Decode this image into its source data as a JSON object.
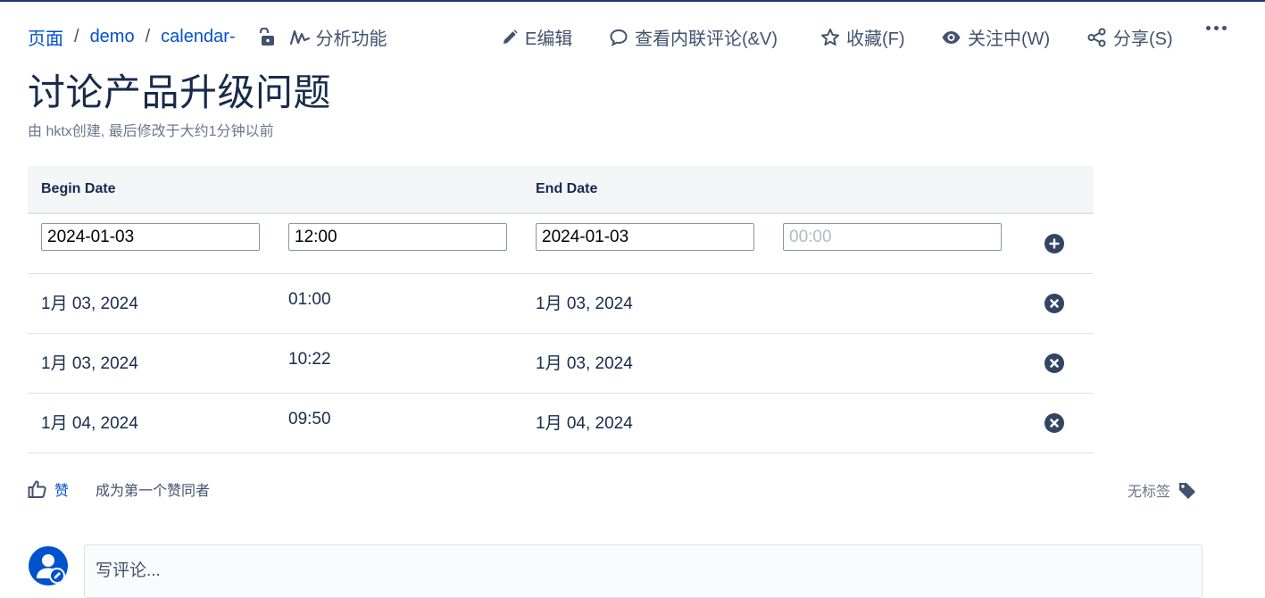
{
  "breadcrumb": {
    "items": [
      "页面",
      "demo",
      "calendar-"
    ],
    "separator": "/",
    "analytics_label": "分析功能"
  },
  "toolbar": {
    "edit_label": "E编辑",
    "inline_comments_label": "查看内联评论(&V)",
    "favorite_label": "收藏(F)",
    "watching_label": "关注中(W)",
    "share_label": "分享(S)",
    "more_label": "更多"
  },
  "page": {
    "title": "讨论产品升级问题",
    "byline": "由 hktx创建, 最后修改于大约1分钟以前"
  },
  "table": {
    "headers": {
      "begin": "Begin Date",
      "end": "End Date"
    },
    "input_row": {
      "begin_date": "2024-01-03",
      "begin_time": "12:00",
      "end_date": "2024-01-03",
      "end_time": "",
      "end_time_placeholder": "00:00"
    },
    "rows": [
      {
        "begin_date": "1月 03, 2024",
        "begin_time": "01:00",
        "end_date": "1月 03, 2024",
        "end_time": ""
      },
      {
        "begin_date": "1月 03, 2024",
        "begin_time": "10:22",
        "end_date": "1月 03, 2024",
        "end_time": ""
      },
      {
        "begin_date": "1月 04, 2024",
        "begin_time": "09:50",
        "end_date": "1月 04, 2024",
        "end_time": ""
      }
    ]
  },
  "footer": {
    "like_label": "赞",
    "first_liker": "成为第一个赞同者",
    "no_labels": "无标签"
  },
  "comment": {
    "placeholder": "写评论..."
  },
  "colors": {
    "link": "#0052cc",
    "text": "#172b4d",
    "muted": "#6b778c",
    "icon_dark": "#344563",
    "header_bg": "#f4f5f7"
  }
}
